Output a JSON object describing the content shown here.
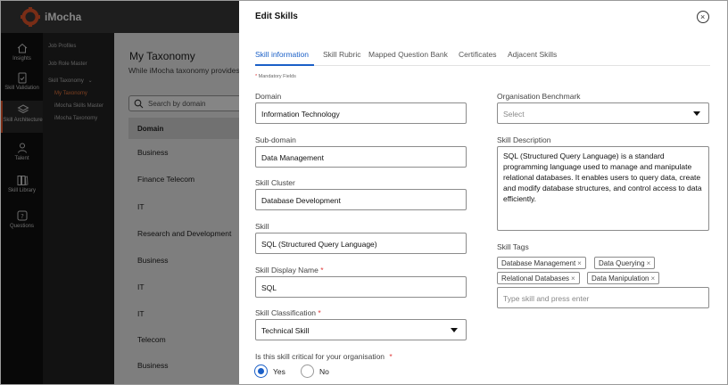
{
  "app": {
    "brand": "iMocha",
    "accent": "#e8572b"
  },
  "rail": {
    "items": [
      {
        "label": "Insights",
        "icon": "home-icon"
      },
      {
        "label": "Skill Validation",
        "icon": "clipboard-check-icon"
      },
      {
        "label": "Skill Architecture",
        "icon": "layers-icon",
        "active": true
      },
      {
        "label": "Talent",
        "icon": "person-icon"
      },
      {
        "label": "Skill Library",
        "icon": "books-icon"
      },
      {
        "label": "Questions",
        "icon": "question-icon"
      }
    ]
  },
  "submenu": {
    "job_profiles": "Job Profiles",
    "job_role_master": "Job Role Master",
    "skill_taxonomy": "Skill Taxonomy",
    "my_taxonomy": "My Taxonomy",
    "skills_master": "iMocha Skills Master",
    "imocha_taxonomy": "iMocha Taxonomy"
  },
  "page": {
    "title": "My Taxonomy",
    "subtitle": "While iMocha taxonomy provides",
    "search_placeholder": "Search by domain",
    "column_header": "Domain",
    "rows": [
      "Business",
      "Finance Telecom",
      "IT",
      "Research and Development",
      "Business",
      "IT",
      "IT",
      "Telecom",
      "Business"
    ]
  },
  "modal": {
    "title": "Edit Skills",
    "tabs": [
      "Skill information",
      "Skill Rubric",
      "Mapped Question Bank",
      "Certificates",
      "Adjacent Skills"
    ],
    "mandatory_note": "Mandatory Fields",
    "domain": {
      "label": "Domain",
      "value": "Information Technology"
    },
    "sub_domain": {
      "label": "Sub-domain",
      "value": "Data Management"
    },
    "skill_cluster": {
      "label": "Skill Cluster",
      "value": "Database Development"
    },
    "skill": {
      "label": "Skill",
      "value": "SQL (Structured Query Language)"
    },
    "display_name": {
      "label": "Skill Display Name",
      "value": "SQL"
    },
    "classification": {
      "label": "Skill Classification",
      "value": "Technical Skill"
    },
    "critical": {
      "label": "Is this skill critical for your organisation",
      "yes": "Yes",
      "no": "No",
      "selected": "Yes"
    },
    "benchmark": {
      "label": "Organisation Benchmark",
      "placeholder": "Select"
    },
    "description": {
      "label": "Skill Description",
      "value": "SQL (Structured Query Language) is a standard programming language used to manage and manipulate relational databases. It enables users to query data, create and modify database structures, and control access to data efficiently."
    },
    "tags": {
      "label": "Skill Tags",
      "items": [
        "Database Management",
        "Data Querying",
        "Relational Databases",
        "Data Manipulation"
      ],
      "placeholder": "Type skill and press enter"
    },
    "required_mark": "*"
  }
}
